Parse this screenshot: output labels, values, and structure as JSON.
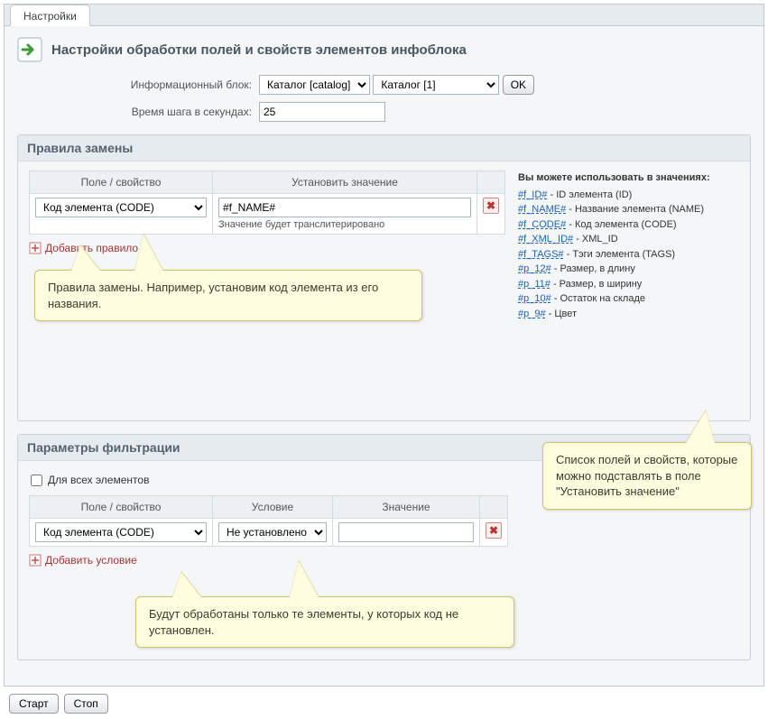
{
  "tab": {
    "label": "Настройки"
  },
  "header": {
    "title": "Настройки обработки полей и свойств элементов инфоблока"
  },
  "form": {
    "iblock_label": "Информационный блок:",
    "iblock_type": "Каталог [catalog]",
    "iblock": "Каталог [1]",
    "ok": "OK",
    "step_label": "Время шага в секундах:",
    "step_value": "25"
  },
  "rules_section": {
    "title": "Правила замены",
    "table": {
      "col_field": "Поле / свойство",
      "col_value": "Установить значение",
      "row": {
        "field": "Код элемента (CODE)",
        "value": "#f_NAME#",
        "hint": "Значение будет транслитерировано"
      }
    },
    "add": "Добавить правило",
    "callout": "Правила замены. Например, установим код элемента из его названия."
  },
  "placeholders": {
    "title": "Вы можете использовать в значениях:",
    "items": [
      {
        "code": "#f_ID#",
        "desc": " - ID элемента (ID)"
      },
      {
        "code": "#f_NAME#",
        "desc": " - Название элемента (NAME)"
      },
      {
        "code": "#f_CODE#",
        "desc": " - Код элемента (CODE)"
      },
      {
        "code": "#f_XML_ID#",
        "desc": " - XML_ID"
      },
      {
        "code": "#f_TAGS#",
        "desc": " - Тэги элемента (TAGS)"
      },
      {
        "code": "#p_12#",
        "desc": " - Размер, в длину"
      },
      {
        "code": "#p_11#",
        "desc": " - Размер, в ширину"
      },
      {
        "code": "#p_10#",
        "desc": " - Остаток на складе"
      },
      {
        "code": "#p_9#",
        "desc": " - Цвет"
      }
    ],
    "callout": "Список полей и свойств, которые можно подставлять в поле \"Установить значение\""
  },
  "filter_section": {
    "title": "Параметры фильтрации",
    "all_elements": "Для всех элементов",
    "table": {
      "col_field": "Поле / свойство",
      "col_cond": "Условие",
      "col_value": "Значение",
      "row": {
        "field": "Код элемента (CODE)",
        "cond": "Не установлено",
        "value": ""
      }
    },
    "add": "Добавить условие",
    "callout": "Будут обработаны только те элементы, у которых код не установлен."
  },
  "footer": {
    "start": "Старт",
    "stop": "Стоп"
  }
}
